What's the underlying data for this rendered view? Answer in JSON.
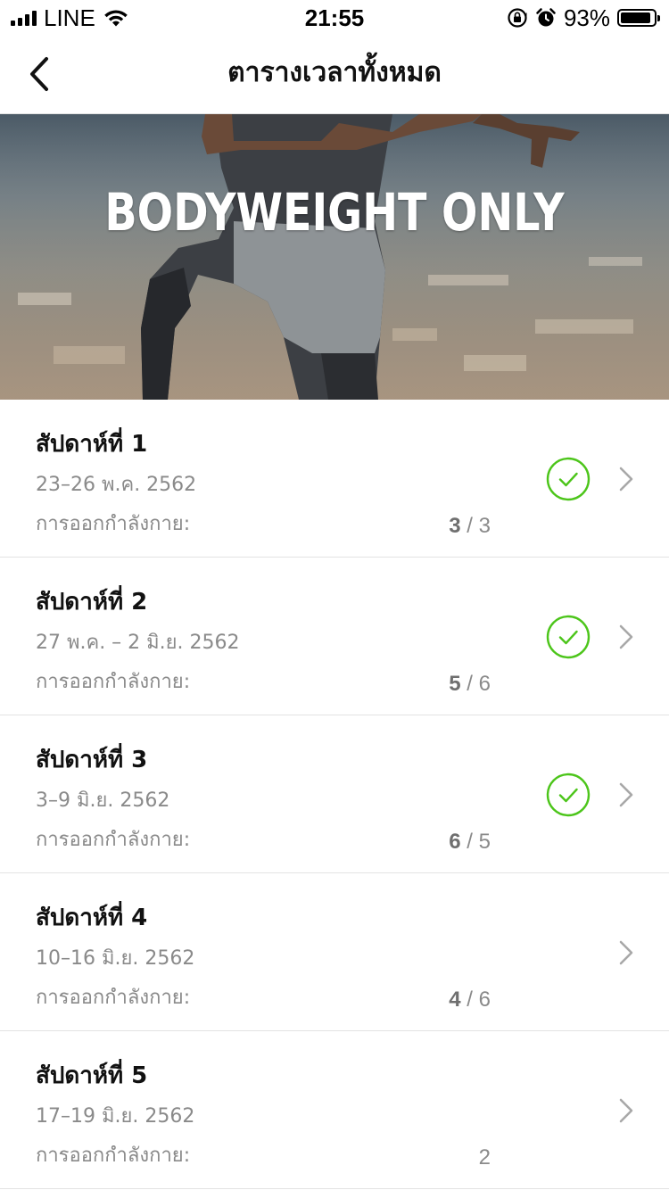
{
  "status_bar": {
    "carrier": "LINE",
    "time": "21:55",
    "battery_percent": "93%",
    "battery_level": 0.93
  },
  "nav": {
    "title": "ตารางเวลาทั้งหมด",
    "back_icon": "chevron-left-icon"
  },
  "hero": {
    "title": "BODYWEIGHT ONLY"
  },
  "weeks": [
    {
      "title": "สัปดาห์ที่ 1",
      "dates": "23–26 พ.ค. 2562",
      "label": "การออกกำลังกาย:",
      "done": "3",
      "sep": " / ",
      "total": "3",
      "completed": true
    },
    {
      "title": "สัปดาห์ที่ 2",
      "dates": "27 พ.ค. – 2 มิ.ย. 2562",
      "label": "การออกกำลังกาย:",
      "done": "5",
      "sep": " / ",
      "total": "6",
      "completed": true
    },
    {
      "title": "สัปดาห์ที่ 3",
      "dates": "3–9 มิ.ย. 2562",
      "label": "การออกกำลังกาย:",
      "done": "6",
      "sep": " / ",
      "total": "5",
      "completed": true
    },
    {
      "title": "สัปดาห์ที่ 4",
      "dates": "10–16 มิ.ย. 2562",
      "label": "การออกกำลังกาย:",
      "done": "4",
      "sep": " / ",
      "total": "6",
      "completed": false
    },
    {
      "title": "สัปดาห์ที่ 5",
      "dates": "17–19 มิ.ย. 2562",
      "label": "การออกกำลังกาย:",
      "done": "",
      "sep": "",
      "total": "2",
      "completed": false
    }
  ],
  "colors": {
    "check_green": "#4cc51a",
    "chevron_gray": "#a8a8a8",
    "secondary_text": "#8a8a8a"
  }
}
